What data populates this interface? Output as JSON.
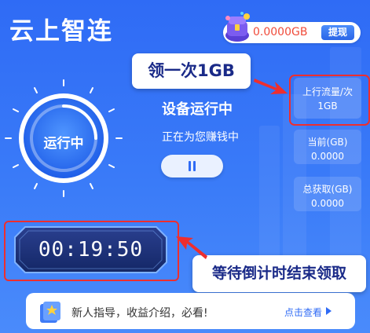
{
  "header": {
    "app_title": "云上智连",
    "balance": "0.0000GB",
    "withdraw_label": "提现"
  },
  "status": {
    "dial_label": "运行中",
    "title": "设备运行中",
    "subtitle": "正在为您赚钱中",
    "pause_icon": "pause-icon"
  },
  "stats": {
    "upload_label": "上行流量/次",
    "upload_value": "1GB",
    "current_label": "当前(GB)",
    "current_value": "0.0000",
    "total_label": "总获取(GB)",
    "total_value": "0.0000"
  },
  "callouts": {
    "top": "领一次1GB",
    "bottom": "等待倒计时结束领取"
  },
  "timer": {
    "value": "00:19:50"
  },
  "guide": {
    "text": "新人指导，收益介绍，必看!",
    "link_label": "点击查看"
  },
  "colors": {
    "background": "#3a7bf8",
    "accent_red": "#ee2e2e",
    "balance_red": "#f04b3a",
    "callout_text": "#1a2a88"
  }
}
